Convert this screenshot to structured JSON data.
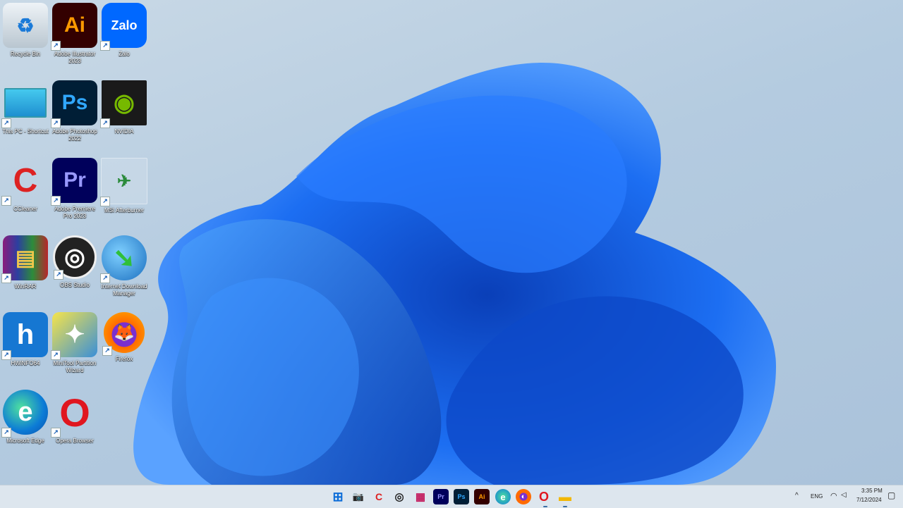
{
  "desktop": {
    "icons": [
      {
        "label": "Recycle Bin",
        "icon": "recycle-bin-icon",
        "glyph": "♻"
      },
      {
        "label": "Adobe Illustrator 2023",
        "icon": "adobe-illustrator-icon",
        "glyph": "Ai"
      },
      {
        "label": "Zalo",
        "icon": "zalo-icon",
        "glyph": "Zalo"
      },
      {
        "label": "This PC - Shortcut",
        "icon": "monitor-icon",
        "glyph": ""
      },
      {
        "label": "Adobe Photoshop 2022",
        "icon": "adobe-photoshop-icon",
        "glyph": "Ps"
      },
      {
        "label": "NVIDIA",
        "icon": "nvidia-icon",
        "glyph": "◉"
      },
      {
        "label": "CCleaner",
        "icon": "ccleaner-icon",
        "glyph": "C"
      },
      {
        "label": "Adobe Premiere Pro 2023",
        "icon": "adobe-premiere-icon",
        "glyph": "Pr"
      },
      {
        "label": "MSI Afterburner",
        "icon": "msi-afterburner-icon",
        "glyph": "✈"
      },
      {
        "label": "WinRAR",
        "icon": "winrar-icon",
        "glyph": "▤"
      },
      {
        "label": "OBS Studio",
        "icon": "obs-icon",
        "glyph": "◎"
      },
      {
        "label": "Internet Download Manager",
        "icon": "idm-icon",
        "glyph": "➘"
      },
      {
        "label": "HWiNFO64",
        "icon": "hwinfo-icon",
        "glyph": "h"
      },
      {
        "label": "MiniTool Partition Wizard",
        "icon": "minitool-icon",
        "glyph": "✦"
      },
      {
        "label": "Firefox",
        "icon": "firefox-icon",
        "glyph": "🦊"
      },
      {
        "label": "Microsoft Edge",
        "icon": "edge-icon",
        "glyph": "e"
      },
      {
        "label": "Opera Browser",
        "icon": "opera-icon",
        "glyph": "O"
      }
    ]
  },
  "taskbar": {
    "apps": [
      {
        "name": "start-button",
        "glyph": "⊞"
      },
      {
        "name": "camera-app",
        "glyph": "📷"
      },
      {
        "name": "ccleaner-app",
        "glyph": "C"
      },
      {
        "name": "obs-app",
        "glyph": "◎"
      },
      {
        "name": "store-app",
        "glyph": "▦"
      },
      {
        "name": "premiere-app",
        "glyph": "Pr"
      },
      {
        "name": "photoshop-app",
        "glyph": "Ps"
      },
      {
        "name": "illustrator-app",
        "glyph": "Ai"
      },
      {
        "name": "edge-app",
        "glyph": "e"
      },
      {
        "name": "firefox-app",
        "glyph": "◐"
      },
      {
        "name": "opera-app",
        "glyph": "O"
      },
      {
        "name": "file-explorer-app",
        "glyph": "▬"
      }
    ],
    "tray": {
      "chevron": "^",
      "language": "ENG",
      "wifi": "◠",
      "volume": "◁",
      "time": "3:35 PM",
      "date": "7/12/2024",
      "notification": "▢"
    }
  }
}
